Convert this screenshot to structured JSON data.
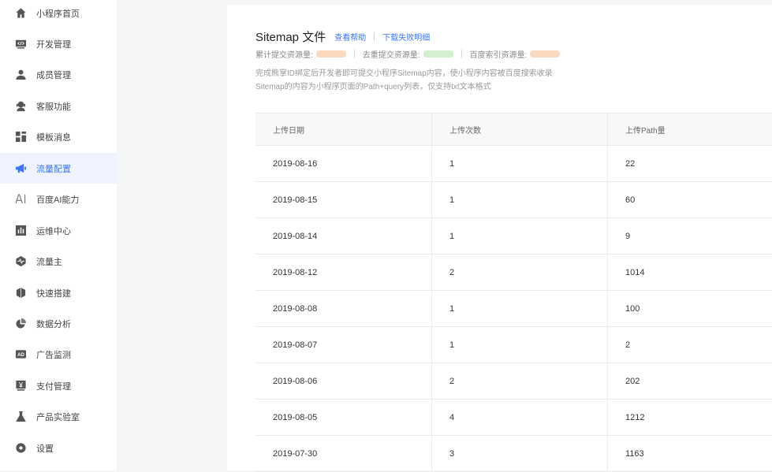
{
  "sidebar": {
    "items": [
      {
        "label": "小程序首页",
        "icon": "home-icon"
      },
      {
        "label": "开发管理",
        "icon": "code-icon"
      },
      {
        "label": "成员管理",
        "icon": "user-icon"
      },
      {
        "label": "客服功能",
        "icon": "headset-icon"
      },
      {
        "label": "模板消息",
        "icon": "template-icon"
      },
      {
        "label": "流量配置",
        "icon": "megaphone-icon",
        "active": true
      },
      {
        "label": "百度AI能力",
        "icon": "ai-icon"
      },
      {
        "label": "运维中心",
        "icon": "bar-chart-icon"
      },
      {
        "label": "流量主",
        "icon": "pulse-icon"
      },
      {
        "label": "快速搭建",
        "icon": "cube-icon"
      },
      {
        "label": "数据分析",
        "icon": "pie-chart-icon"
      },
      {
        "label": "广告监测",
        "icon": "ad-icon"
      },
      {
        "label": "支付管理",
        "icon": "yen-icon"
      },
      {
        "label": "产品实验室",
        "icon": "flask-icon"
      },
      {
        "label": "设置",
        "icon": "gear-icon"
      }
    ]
  },
  "main": {
    "title": "Sitemap 文件",
    "help_link": "查看帮助",
    "failure_link": "下载失败明细",
    "stats": [
      {
        "label": "累计提交资源量:"
      },
      {
        "label": "去重提交资源量:"
      },
      {
        "label": "百度索引资源量:"
      }
    ],
    "desc_line1": "完成熊掌ID绑定后开发者即可提交小程序Sitemap内容，使小程序内容被百度搜索收录",
    "desc_line2": "Sitemap的内容为小程序页面的Path+query列表，仅支持txt文本格式",
    "table": {
      "headers": [
        "上传日期",
        "上传次数",
        "上传Path量"
      ],
      "rows": [
        [
          "2019-08-16",
          "1",
          "22"
        ],
        [
          "2019-08-15",
          "1",
          "60"
        ],
        [
          "2019-08-14",
          "1",
          "9"
        ],
        [
          "2019-08-12",
          "2",
          "1014"
        ],
        [
          "2019-08-08",
          "1",
          "100"
        ],
        [
          "2019-08-07",
          "1",
          "2"
        ],
        [
          "2019-08-06",
          "2",
          "202"
        ],
        [
          "2019-08-05",
          "4",
          "1212"
        ],
        [
          "2019-07-30",
          "3",
          "1163"
        ]
      ]
    }
  },
  "colors": {
    "accent": "#3c76f6",
    "active_bg": "#eef3fe",
    "blur_orange": "#fbd9bf",
    "blur_green": "#d3efcf"
  }
}
